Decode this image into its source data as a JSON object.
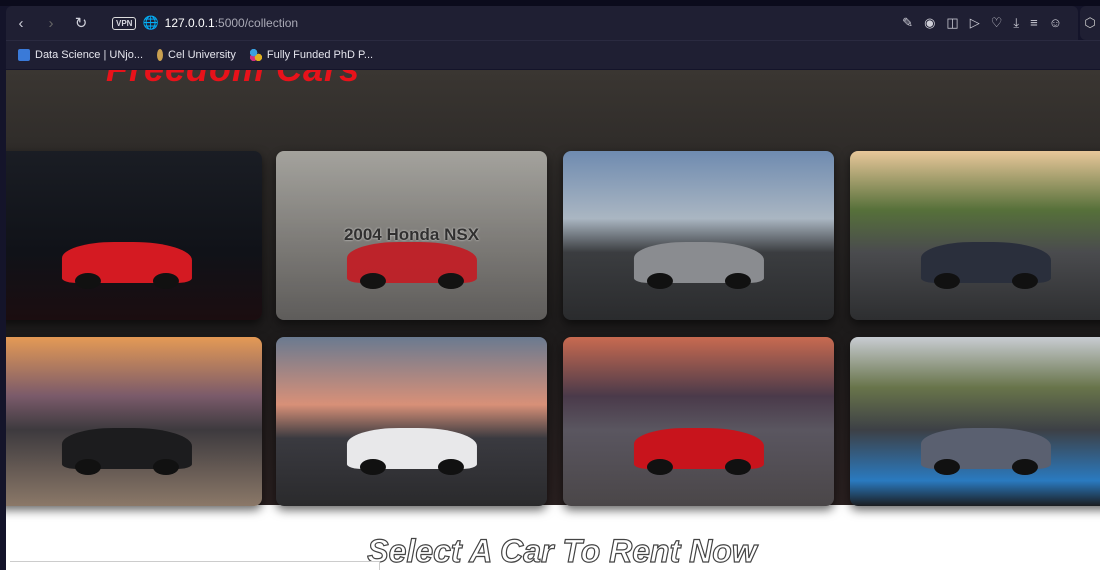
{
  "browser": {
    "url_host": "127.0.0.1",
    "url_path": ":5000/collection",
    "vpn": "VPN",
    "bookmarks": [
      {
        "label": "Data Science | UNjo..."
      },
      {
        "label": "Cel University"
      },
      {
        "label": "Fully Funded PhD P..."
      }
    ]
  },
  "site": {
    "logo": "Freedom Cars",
    "heading": "Select A Car To Rent Now"
  },
  "cards": [
    {
      "name": "",
      "bg": "linear-gradient(180deg,#1a1d24,#101218 60%,#1b0d10)",
      "car": "#d41a22"
    },
    {
      "name": "2004 Honda NSX",
      "bg": "linear-gradient(180deg,#b9b8b2,#8c8a86 55%,#6a6866)",
      "car": "#d8242c"
    },
    {
      "name": "",
      "bg": "linear-gradient(180deg,#6f8bb0,#aab6c2 40%,#3b3d40 60%,#2a2b2d)",
      "car": "#8a8c90"
    },
    {
      "name": "",
      "bg": "linear-gradient(180deg,#e8c79a,#56703a 35%,#4a4b4e 60%,#2d2e30)",
      "car": "#2a2f3c"
    },
    {
      "name": "",
      "bg": "linear-gradient(180deg,#e49a55,#7a5a6a 35%,#3d3a3e 55%,#8b7868)",
      "car": "#1c1c1e"
    },
    {
      "name": "",
      "bg": "linear-gradient(180deg,#6a7a90,#d89078 40%,#3a3a40 60%,#2a2a2c)",
      "car": "#e8e8ea"
    },
    {
      "name": "",
      "bg": "linear-gradient(180deg,#c86a50,#4a3a4a 35%,#5a5660 55%,#4a4648)",
      "car": "#c8141c"
    },
    {
      "name": "",
      "bg": "linear-gradient(180deg,#c8ccd2,#68744a 30%,#3d4046 55%,#2a7ac0 85%,#1b1d20)",
      "car": "#5a6070"
    }
  ]
}
